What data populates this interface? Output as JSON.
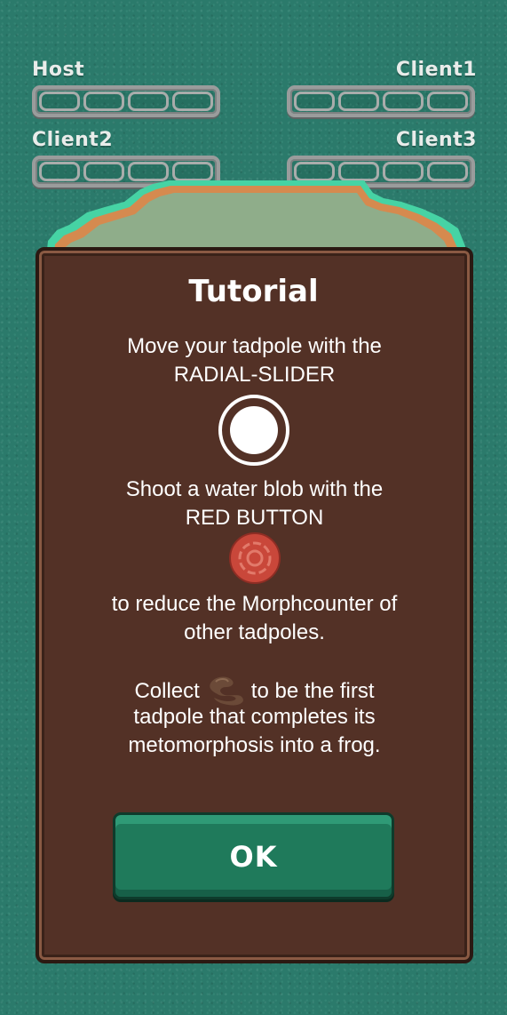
{
  "players": {
    "host": {
      "label": "Host",
      "segments_filled": 0,
      "segments_total": 4
    },
    "client1": {
      "label": "Client1",
      "segments_filled": 0,
      "segments_total": 4
    },
    "client2": {
      "label": "Client2",
      "segments_filled": 0,
      "segments_total": 4
    },
    "client3": {
      "label": "Client3",
      "segments_filled": 0,
      "segments_total": 4
    }
  },
  "tutorial": {
    "title": "Tutorial",
    "move_line1": "Move your tadpole with the",
    "move_line2": "RADIAL-SLIDER",
    "shoot_line1": "Shoot a water blob with the",
    "shoot_line2": "RED BUTTON",
    "reduce_line1": "to reduce the Morphcounter of",
    "reduce_line2": "other tadpoles.",
    "collect_prefix": "Collect",
    "collect_suffix": "to be the first",
    "collect_line2": "tadpole that completes its",
    "collect_line3": "metomorphosis into a frog.",
    "ok_label": "OK"
  },
  "icons": {
    "slider": "radial-slider-icon",
    "red_button": "red-button-icon",
    "collectible": "morph-item-icon"
  },
  "colors": {
    "water": "#2b7a6b",
    "panel": "#533126",
    "ok_button": "#1f7a5b",
    "red_button": "#c9473a"
  }
}
